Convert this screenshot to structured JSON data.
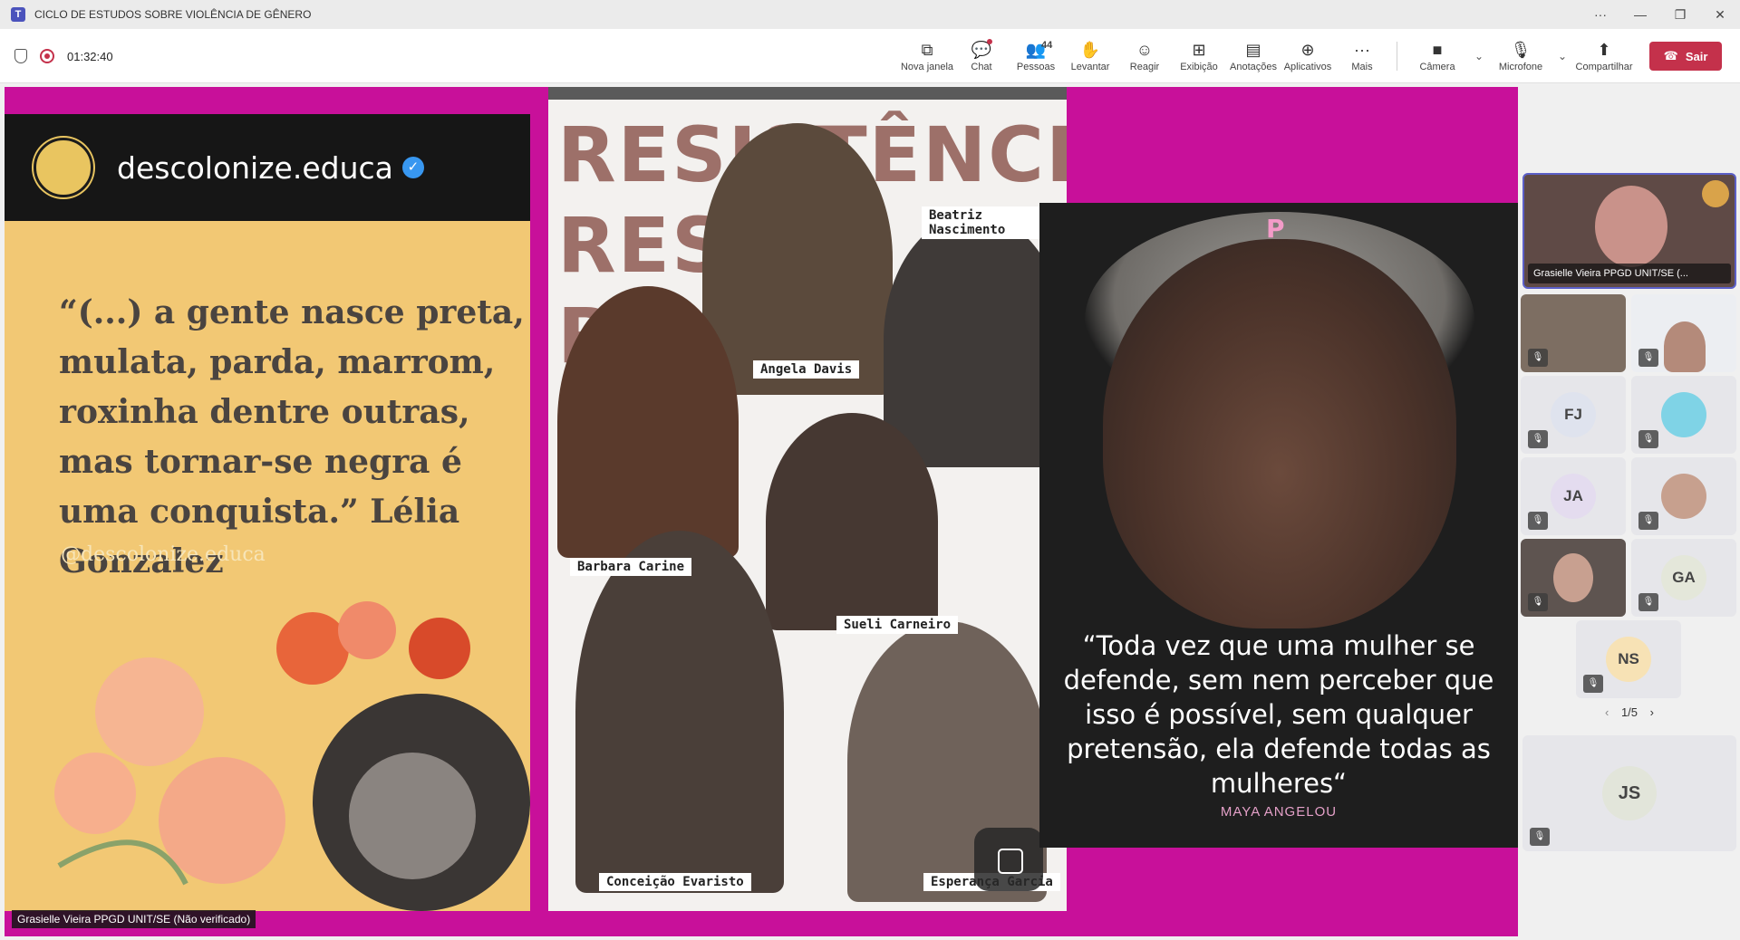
{
  "window": {
    "title": "CICLO DE ESTUDOS SOBRE VIOLÊNCIA DE GÊNERO",
    "app_icon": "T"
  },
  "meeting": {
    "timer": "01:32:40"
  },
  "toolbar": {
    "buttons": [
      {
        "label": "Nova janela",
        "icon": "⧉"
      },
      {
        "label": "Chat",
        "icon": "💬"
      },
      {
        "label": "Pessoas",
        "icon": "👥",
        "count": "44"
      },
      {
        "label": "Levantar",
        "icon": "✋"
      },
      {
        "label": "Reagir",
        "icon": "☺"
      },
      {
        "label": "Exibição",
        "icon": "⊞"
      },
      {
        "label": "Anotações",
        "icon": "▤"
      },
      {
        "label": "Aplicativos",
        "icon": "⊕"
      },
      {
        "label": "Mais",
        "icon": "···"
      }
    ],
    "camera_label": "Câmera",
    "mic_label": "Microfone",
    "share_label": "Compartilhar",
    "leave_label": "Sair"
  },
  "shared": {
    "panel1": {
      "handle": "descolonize.educa",
      "quote": "“(...) a gente nasce preta, mulata, parda, marrom, roxinha dentre outras, mas tornar-se negra é uma conquista.” Lélia Gonzalez",
      "watermark": "@descolonize.educa"
    },
    "panel2": {
      "title_lines": [
        "RESISTÊNCIA",
        "RESI",
        "RE"
      ],
      "labels": [
        "Beatriz Nascimento",
        "Angela Davis",
        "Barbara Carine",
        "Sueli Carneiro",
        "Conceição Evaristo",
        "Esperança Garcia"
      ]
    },
    "panel3": {
      "logo": "P",
      "quote": "“Toda vez que uma mulher se defende, sem nem perceber que isso é possível, sem qualquer pretensão, ela defende todas as mulheres“",
      "author": "MAYA ANGELOU"
    },
    "presenter_caption": "Grasielle Vieira PPGD UNIT/SE (Não verificado)"
  },
  "participants": {
    "presenter_name": "Grasielle Vieira PPGD UNIT/SE (...",
    "tiles": [
      {
        "initials": "FJ",
        "color": "#dfe3ee"
      },
      {
        "initials": "",
        "color": "#7fd3e6"
      },
      {
        "initials": "JA",
        "color": "#e4dcef"
      },
      {
        "initials": "GA",
        "color": "#e4e7da"
      },
      {
        "initials": "NS",
        "color": "#f7e2b5"
      },
      {
        "initials": "JS",
        "color": "#e2e5da"
      }
    ],
    "pager": "1/5",
    "colors": {
      "accent": "#5b5fc7",
      "leave": "#c4314b",
      "stage": "#c8109a"
    }
  }
}
